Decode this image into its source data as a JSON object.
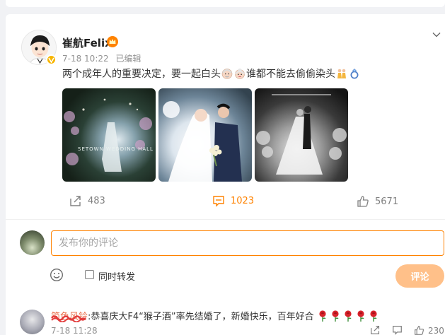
{
  "post": {
    "username": "崔航Felix",
    "time": "7-18 10:22",
    "edited": "已编辑",
    "text_a": "两个成年人的重要决定，要一起白头",
    "text_b": "谁都不能去偷偷染头",
    "photo_caption": "SETOWN WEDDING HALL",
    "icons": [
      "verified-badge-icon",
      "crown-icon",
      "chevron-down-icon",
      "old-man-emoji",
      "old-woman-emoji",
      "couple-emoji",
      "ring-emoji"
    ]
  },
  "actions": {
    "share_count": "483",
    "comment_count": "1023",
    "like_count": "5671"
  },
  "composer": {
    "placeholder": "发布你的评论",
    "repost_label": "同时转发",
    "submit_label": "评论"
  },
  "comment": {
    "username": "简色风铃",
    "text": ":恭喜庆大F4“猴子酒”率先结婚了，新婚快乐，百年好合",
    "time": "7-18 11:28",
    "like_count": "230",
    "rose_count": 5
  },
  "colors": {
    "accent": "#ff8200",
    "submit_disabled": "#ffc089",
    "username_link": "#eb7350",
    "background": "#f1f2f5"
  }
}
